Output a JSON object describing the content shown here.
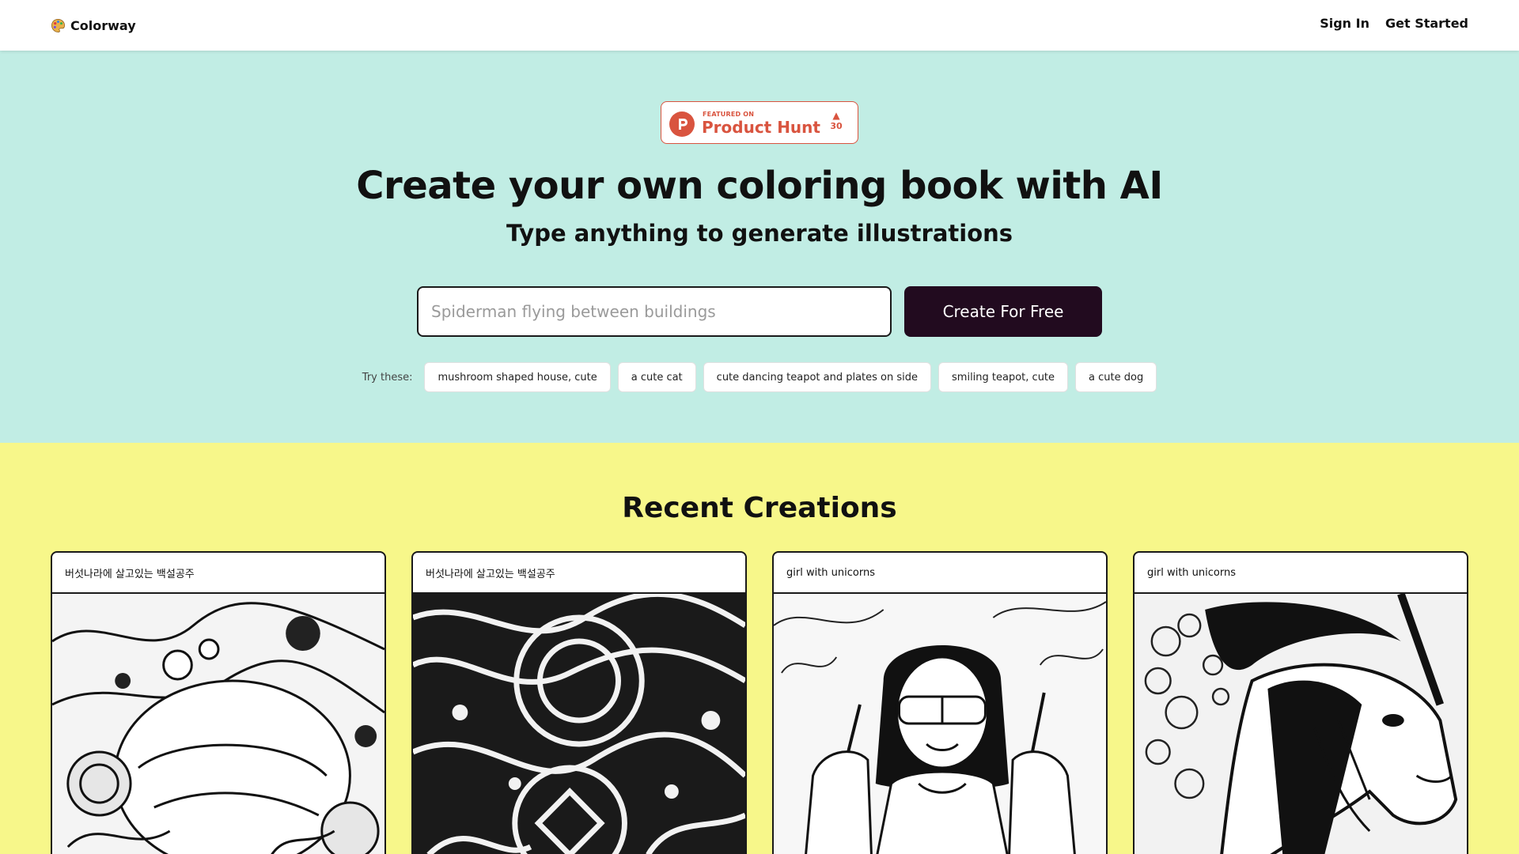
{
  "header": {
    "brand": "Colorway",
    "nav": {
      "sign_in": "Sign In",
      "get_started": "Get Started"
    }
  },
  "hero": {
    "badge": {
      "featured": "FEATURED ON",
      "name": "Product Hunt",
      "votes": "30"
    },
    "title": "Create your own coloring book with AI",
    "subtitle": "Type anything to generate illustrations",
    "search": {
      "placeholder": "Spiderman flying between buildings",
      "value": ""
    },
    "cta_label": "Create For Free",
    "try_label": "Try these:",
    "suggestions": [
      "mushroom shaped house, cute",
      "a cute cat",
      "cute dancing teapot and plates on side",
      "smiling teapot, cute",
      "a cute dog"
    ]
  },
  "recent": {
    "title": "Recent Creations",
    "cards": [
      {
        "caption": "버섯나라에 살고있는 백설공주",
        "image": "mushroom-forest-lineart"
      },
      {
        "caption": "버섯나라에 살고있는 백설공주",
        "image": "swirl-pattern-lineart"
      },
      {
        "caption": "girl with unicorns",
        "image": "girl-with-unicorns-lineart"
      },
      {
        "caption": "girl with unicorns",
        "image": "unicorn-head-lineart"
      }
    ]
  },
  "colors": {
    "hero_bg": "#c1ede4",
    "recent_bg": "#f7f78a",
    "cta_bg": "#220b1f",
    "product_hunt": "#d9543f"
  }
}
